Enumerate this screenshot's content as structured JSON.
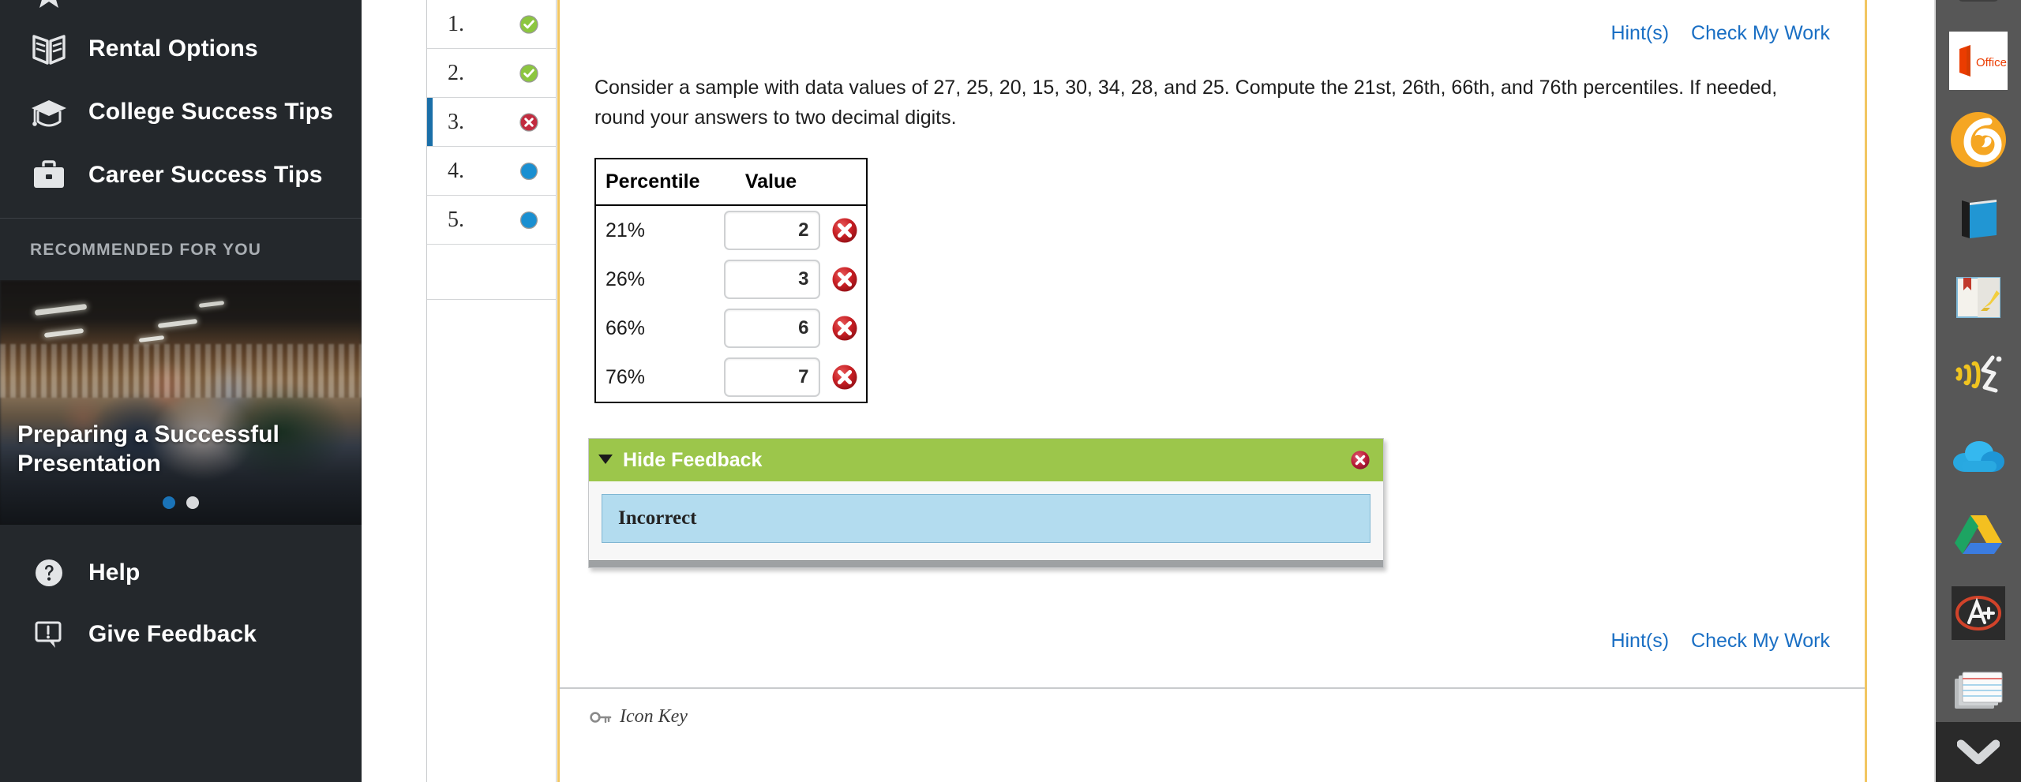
{
  "sidebar": {
    "nav_items": [
      {
        "label": "Rental Options",
        "icon": "open-book-icon"
      },
      {
        "label": "College Success Tips",
        "icon": "graduation-cap-icon"
      },
      {
        "label": "Career Success Tips",
        "icon": "briefcase-icon"
      }
    ],
    "partial_icon": "bookmark-star-icon",
    "recommended_header": "RECOMMENDED FOR YOU",
    "promo": {
      "title": "Preparing a Successful Presentation",
      "dots": 2,
      "active_dot": 0
    },
    "bottom_items": [
      {
        "label": "Help",
        "icon": "help-circle-icon"
      },
      {
        "label": "Give Feedback",
        "icon": "feedback-bubble-icon"
      }
    ],
    "colors": {
      "background": "#24282c",
      "accent_blue": "#1a73b7"
    }
  },
  "question_list": {
    "items": [
      {
        "number": "1.",
        "status": "correct",
        "current": false
      },
      {
        "number": "2.",
        "status": "correct",
        "current": false
      },
      {
        "number": "3.",
        "status": "incorrect",
        "current": true
      },
      {
        "number": "4.",
        "status": "unanswered",
        "current": false
      },
      {
        "number": "5.",
        "status": "unanswered",
        "current": false
      }
    ],
    "status_colors": {
      "correct": "#8cc63f",
      "incorrect": "#c22b3f",
      "unanswered": "#1a8fd1"
    }
  },
  "content": {
    "top_links": [
      {
        "label": "Hint(s)",
        "name": "hints-link"
      },
      {
        "label": "Check My Work",
        "name": "check-my-work-link"
      }
    ],
    "bottom_links": [
      {
        "label": "Hint(s)",
        "name": "hints-link"
      },
      {
        "label": "Check My Work",
        "name": "check-my-work-link"
      }
    ],
    "question_text": "Consider a sample with data values of 27, 25, 20, 15, 30, 34, 28, and 25. Compute the 21st, 26th, 66th, and 76th percentiles. If needed, round your answers to two decimal digits.",
    "table": {
      "headers": [
        "Percentile",
        "Value"
      ],
      "rows": [
        {
          "percentile": "21%",
          "value": "2",
          "status": "incorrect"
        },
        {
          "percentile": "26%",
          "value": "3",
          "status": "incorrect"
        },
        {
          "percentile": "66%",
          "value": "6",
          "status": "incorrect"
        },
        {
          "percentile": "76%",
          "value": "7",
          "status": "incorrect"
        }
      ],
      "input_placeholder": ""
    },
    "feedback": {
      "toggle_label": "Hide Feedback",
      "message": "Incorrect",
      "close_icon": "close-circle-icon",
      "header_color": "#9cc64b",
      "alert_color": "#b3dcef"
    },
    "icon_key": {
      "label": "Icon Key",
      "icon": "key-icon"
    },
    "border_color": "#f2c661"
  },
  "dock": {
    "items": [
      {
        "name": "dock-item-top-clipped",
        "icon": "clipped-icon",
        "label": ""
      },
      {
        "name": "dock-item-office",
        "icon": "ms-office-icon",
        "label": "Office"
      },
      {
        "name": "dock-item-bookshelf",
        "icon": "orange-six-icon",
        "label": ""
      },
      {
        "name": "dock-item-ebook",
        "icon": "blue-book-icon",
        "label": ""
      },
      {
        "name": "dock-item-highlighter",
        "icon": "book-highlighter-icon",
        "label": ""
      },
      {
        "name": "dock-item-read-aloud",
        "icon": "read-aloud-icon",
        "label": ""
      },
      {
        "name": "dock-item-onedrive",
        "icon": "onedrive-cloud-icon",
        "label": ""
      },
      {
        "name": "dock-item-google-drive",
        "icon": "google-drive-icon",
        "label": ""
      },
      {
        "name": "dock-item-grades",
        "icon": "a-plus-icon",
        "label": ""
      },
      {
        "name": "dock-item-flashcards",
        "icon": "flashcards-icon",
        "label": ""
      }
    ],
    "expand": {
      "icon": "chevron-down-icon"
    },
    "background": "#575757"
  }
}
